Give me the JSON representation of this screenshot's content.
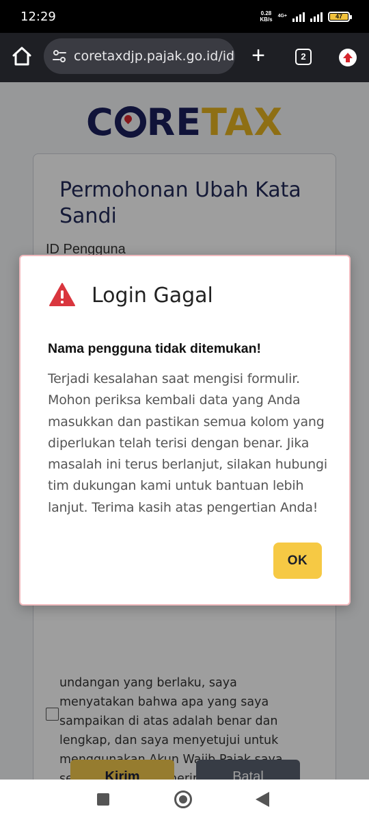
{
  "status_bar": {
    "time": "12:29",
    "net_speed_value": "0.28",
    "net_speed_unit": "KB/s",
    "network_type": "4G+",
    "battery": "47"
  },
  "browser": {
    "url": "coretaxdjp.pajak.go.id/ide",
    "tab_count": "2"
  },
  "logo": {
    "part1": "C",
    "part2": "RE",
    "part3": "TAX"
  },
  "form": {
    "title": "Permohonan Ubah Kata Sandi",
    "field_label": "ID Pengguna",
    "declaration": "undangan yang berlaku, saya menyatakan bahwa apa yang saya sampaikan di atas adalah benar dan lengkap, dan saya menyetujui untuk menggunakan Akun Wajib Pajak saya sebagai sarana penerimaan surat dan dokumen perpajakan.",
    "submit_label": "Kirim",
    "cancel_label": "Batal"
  },
  "modal": {
    "title": "Login Gagal",
    "heading": "Nama pengguna tidak ditemukan!",
    "message": "Terjadi kesalahan saat mengisi formulir. Mohon periksa kembali data yang Anda masukkan dan pastikan semua kolom yang diperlukan telah terisi dengan benar. Jika masalah ini terus berlanjut, silakan hubungi tim dukungan kami untuk bantuan lebih lanjut. Terima kasih atas pengertian Anda!",
    "ok_label": "OK"
  },
  "colors": {
    "brand_navy": "#1b1f5c",
    "brand_gold": "#e6b321",
    "ok_button": "#f6c944",
    "warning_red": "#d9363e"
  },
  "icons": {
    "browser_home": "home-icon",
    "url_settings": "site-settings-icon",
    "new_tab": "plus-icon",
    "update": "update-arrow-icon",
    "modal_warning": "warning-triangle-icon"
  }
}
